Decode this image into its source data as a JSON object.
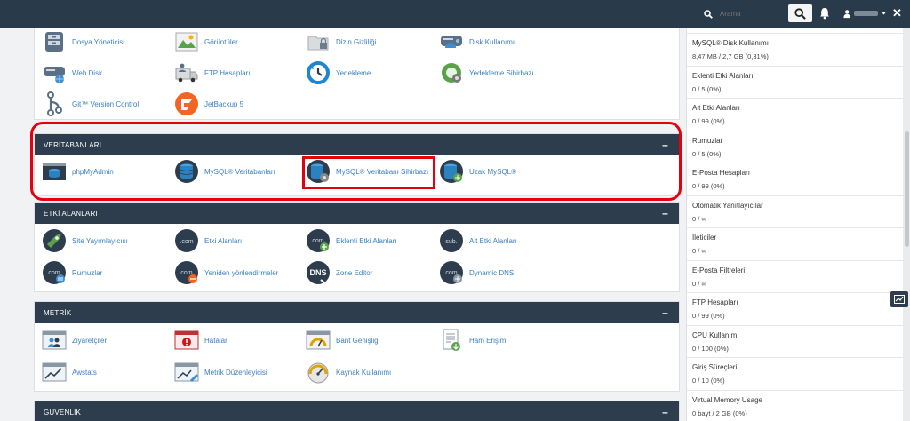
{
  "search": {
    "placeholder": "Arama"
  },
  "colors": {
    "topbar": "#293a4a",
    "panel_header": "#2e3d4d",
    "link": "#3a7fc1",
    "highlight": "#e3000f"
  },
  "files": {
    "items": [
      {
        "label": "Dosya Yöneticisi",
        "icon": "file-manager-icon"
      },
      {
        "label": "Görüntüler",
        "icon": "images-icon"
      },
      {
        "label": "Dizin Gizliliği",
        "icon": "directory-privacy-icon"
      },
      {
        "label": "Disk Kullanımı",
        "icon": "disk-usage-icon"
      },
      {
        "label": "Web Disk",
        "icon": "web-disk-icon"
      },
      {
        "label": "FTP Hesapları",
        "icon": "ftp-accounts-icon"
      },
      {
        "label": "Yedekleme",
        "icon": "backup-icon"
      },
      {
        "label": "Yedekleme Sihirbazı",
        "icon": "backup-wizard-icon"
      },
      {
        "label": "Git™ Version Control",
        "icon": "git-icon"
      },
      {
        "label": "JetBackup 5",
        "icon": "jetbackup-icon"
      }
    ]
  },
  "databases": {
    "title": "VERİTABANLARI",
    "items": [
      {
        "label": "phpMyAdmin",
        "icon": "phpmyadmin-icon"
      },
      {
        "label": "MySQL® Veritabanları",
        "icon": "mysql-databases-icon"
      },
      {
        "label": "MySQL® Veritabanı Sihirbazı",
        "icon": "mysql-wizard-icon"
      },
      {
        "label": "Uzak MySQL®",
        "icon": "remote-mysql-icon"
      }
    ]
  },
  "domains": {
    "title": "ETKİ ALANLARI",
    "items": [
      {
        "label": "Site Yayımlayıcısı",
        "icon": "site-publisher-icon"
      },
      {
        "label": "Etki Alanları",
        "icon": "domains-icon",
        "badge": ".com"
      },
      {
        "label": "Eklenti Etki Alanları",
        "icon": "addon-domains-icon",
        "badge": ".com"
      },
      {
        "label": "Alt Etki Alanları",
        "icon": "subdomains-icon",
        "badge": "sub."
      },
      {
        "label": "Rumuzlar",
        "icon": "aliases-icon",
        "badge": ".com"
      },
      {
        "label": "Yeniden yönlendirmeler",
        "icon": "redirects-icon",
        "badge": ".com"
      },
      {
        "label": "Zone Editor",
        "icon": "zone-editor-icon",
        "badge": "DNS"
      },
      {
        "label": "Dynamic DNS",
        "icon": "dynamic-dns-icon",
        "badge": ".com"
      }
    ]
  },
  "metrics": {
    "title": "METRİK",
    "items": [
      {
        "label": "Ziyaretçiler",
        "icon": "visitors-icon"
      },
      {
        "label": "Hatalar",
        "icon": "errors-icon"
      },
      {
        "label": "Bant Genişliği",
        "icon": "bandwidth-icon"
      },
      {
        "label": "Ham Erişim",
        "icon": "raw-access-icon"
      },
      {
        "label": "Awstats",
        "icon": "awstats-icon"
      },
      {
        "label": "Metrik Düzenleyicisi",
        "icon": "metrics-editor-icon"
      },
      {
        "label": "Kaynak Kullanımı",
        "icon": "resource-usage-icon"
      }
    ]
  },
  "security": {
    "title": "GÜVENLİK"
  },
  "stats": [
    {
      "title": "MySQL® Disk Kullanımı",
      "value": "8,47 MB / 2,7 GB   (0,31%)"
    },
    {
      "title": "Eklenti Etki Alanları",
      "value": "0 / 5   (0%)"
    },
    {
      "title": "Alt Etki Alanları",
      "value": "0 / 99   (0%)"
    },
    {
      "title": "Rumuzlar",
      "value": "0 / 5   (0%)"
    },
    {
      "title": "E-Posta Hesapları",
      "value": "0 / 99   (0%)"
    },
    {
      "title": "Otomatik Yanıtlayıcılar",
      "value": "0 / ∞"
    },
    {
      "title": "İleticiler",
      "value": "0 / ∞"
    },
    {
      "title": "E-Posta Filtreleri",
      "value": "0 / ∞"
    },
    {
      "title": "FTP Hesapları",
      "value": "0 / 99   (0%)"
    },
    {
      "title": "CPU Kullanımı",
      "value": "0 / 100   (0%)"
    },
    {
      "title": "Giriş Süreçleri",
      "value": "0 / 10   (0%)"
    },
    {
      "title": "Virtual Memory Usage",
      "value": "0 bayt / 2 GB   (0%)"
    }
  ]
}
